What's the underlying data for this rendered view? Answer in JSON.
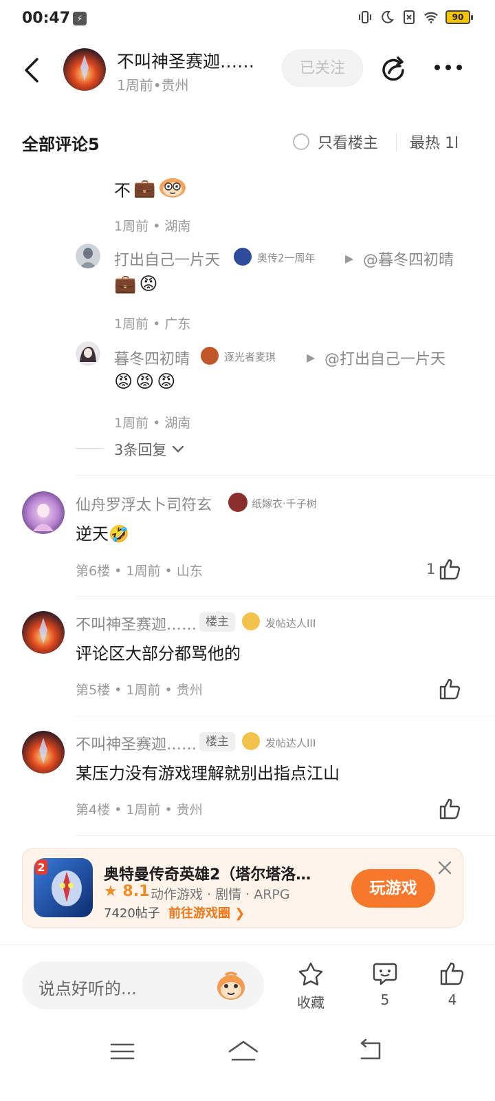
{
  "status_bar": {
    "time": "00:47",
    "battery": "90"
  },
  "header": {
    "author_name": "不叫神圣赛迦……",
    "author_meta": "1周前•贵州",
    "follow_label": "已关注"
  },
  "comments_header": {
    "title": "全部评论5",
    "only_author_label": "只看楼主",
    "sort_label": "最热 1l"
  },
  "thread": {
    "top_reply_text": "不",
    "top_reply_meta": "1周前 • 湖南",
    "replies": [
      {
        "user": "打出自己一片天",
        "badge": "奥传2一周年",
        "reply_to": "@暮冬四初晴",
        "meta": "1周前 • 广东"
      },
      {
        "user": "暮冬四初晴",
        "badge": "逐光者麦琪",
        "reply_to": "@打出自己一片天",
        "meta": "1周前 • 湖南"
      }
    ],
    "more_replies": "3条回复"
  },
  "comments": [
    {
      "user": "仙舟罗浮太卜司符玄",
      "badge": "纸嫁衣·千子树",
      "text": "逆天🤣",
      "meta": "第6楼 • 1周前 • 山东",
      "likes": "1"
    },
    {
      "user": "不叫神圣赛迦……",
      "owner_tag": "楼主",
      "badge": "发帖达人III",
      "text": "评论区大部分都骂他的",
      "meta": "第5楼 • 1周前 • 贵州",
      "likes": ""
    },
    {
      "user": "不叫神圣赛迦……",
      "owner_tag": "楼主",
      "badge": "发帖达人III",
      "text": "某压力没有游戏理解就别出指点江山",
      "meta": "第4楼 • 1周前 • 贵州",
      "likes": ""
    }
  ],
  "ad": {
    "title": "奥特曼传奇英雄2（塔尔塔洛…",
    "rating": "8.1",
    "tags": "动作游戏 · 剧情 · ARPG",
    "posts": "7420帖子",
    "link": "前往游戏圈",
    "play": "玩游戏"
  },
  "bottom_bar": {
    "placeholder": "说点好听的...",
    "collect_label": "收藏",
    "comment_count": "5",
    "like_count": "4"
  },
  "colors": {
    "accent": "#f7782a",
    "muted": "#9a9a9a"
  }
}
